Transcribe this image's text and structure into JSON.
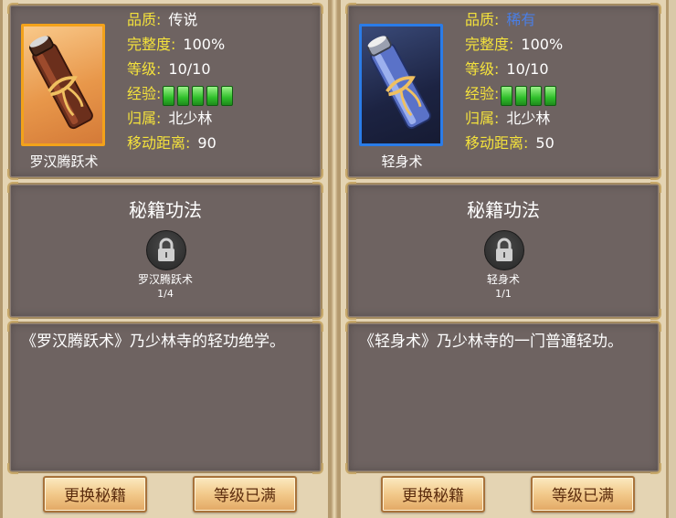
{
  "books": [
    {
      "name": "罗汉腾跃术",
      "rarity": "legend",
      "stats": {
        "quality_label": "品质:",
        "quality_value": "传说",
        "integrity_label": "完整度:",
        "integrity_value": "100%",
        "level_label": "等级:",
        "level_value": "10/10",
        "exp_label": "经验:",
        "exp_pips_filled": 5,
        "exp_pips_total": 5,
        "belong_label": "归属:",
        "belong_value": "北少林",
        "move_label": "移动距离:",
        "move_value": "90"
      },
      "skill_section": {
        "title": "秘籍功法",
        "skill_name": "罗汉腾跃术",
        "skill_count": "1/4",
        "icon": "lock-icon"
      },
      "description": "《罗汉腾跃术》乃少林寺的轻功绝学。",
      "buttons": {
        "change": "更换秘籍",
        "level": "等级已满"
      },
      "colors": {
        "frame": "#f3a21a",
        "quality": "#ffffff"
      }
    },
    {
      "name": "轻身术",
      "rarity": "rare",
      "stats": {
        "quality_label": "品质:",
        "quality_value": "稀有",
        "integrity_label": "完整度:",
        "integrity_value": "100%",
        "level_label": "等级:",
        "level_value": "10/10",
        "exp_label": "经验:",
        "exp_pips_filled": 4,
        "exp_pips_total": 4,
        "belong_label": "归属:",
        "belong_value": "北少林",
        "move_label": "移动距离:",
        "move_value": "50"
      },
      "skill_section": {
        "title": "秘籍功法",
        "skill_name": "轻身术",
        "skill_count": "1/1",
        "icon": "lock-icon"
      },
      "description": "《轻身术》乃少林寺的一门普通轻功。",
      "buttons": {
        "change": "更换秘籍",
        "level": "等级已满"
      },
      "colors": {
        "frame": "#2a7ce8",
        "quality": "#4a7fe6"
      }
    }
  ]
}
